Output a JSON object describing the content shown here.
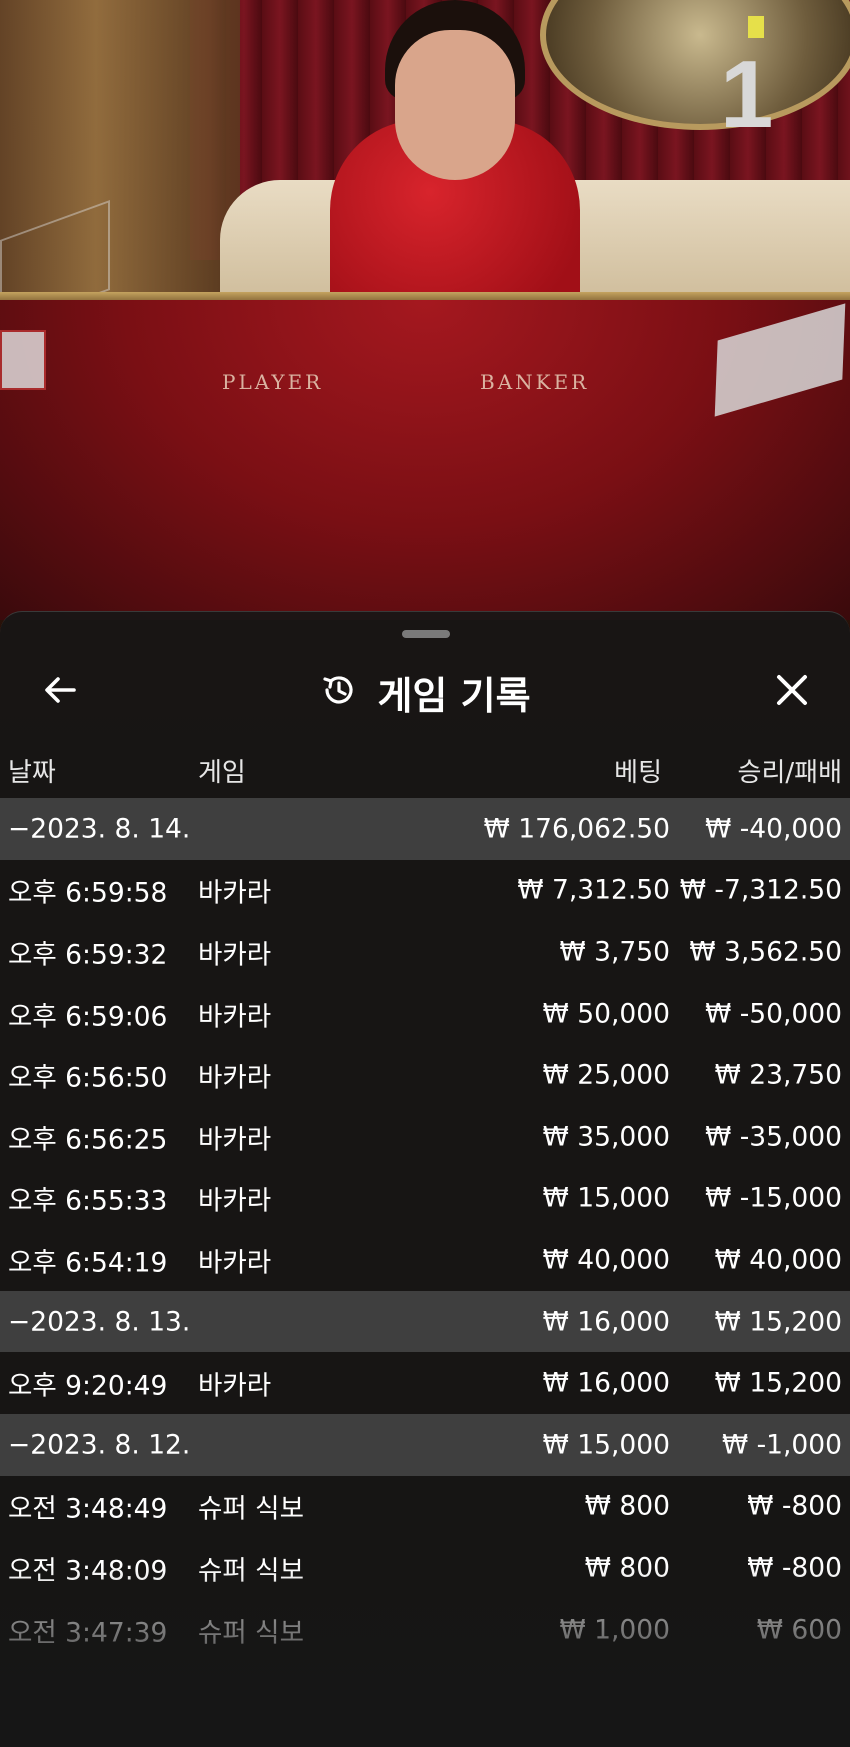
{
  "stream": {
    "round_number": "1",
    "table_labels": {
      "player": "PLAYER",
      "banker": "BANKER"
    }
  },
  "panel": {
    "title": "게임 기록",
    "icons": {
      "back": "arrow-left-icon",
      "history": "history-icon",
      "close": "close-icon"
    },
    "columns": {
      "date": "날짜",
      "game": "게임",
      "bet": "베팅",
      "win_loss": "승리/패배"
    },
    "rows": [
      {
        "type": "group",
        "date": "−2023. 8. 14.",
        "bet": "₩ 176,062.50",
        "win_loss": "₩ -40,000"
      },
      {
        "type": "entry",
        "time": "오후 6:59:58",
        "game": "바카라",
        "bet": "₩ 7,312.50",
        "win_loss": "₩ -7,312.50"
      },
      {
        "type": "entry",
        "time": "오후 6:59:32",
        "game": "바카라",
        "bet": "₩ 3,750",
        "win_loss": "₩ 3,562.50"
      },
      {
        "type": "entry",
        "time": "오후 6:59:06",
        "game": "바카라",
        "bet": "₩ 50,000",
        "win_loss": "₩ -50,000"
      },
      {
        "type": "entry",
        "time": "오후 6:56:50",
        "game": "바카라",
        "bet": "₩ 25,000",
        "win_loss": "₩ 23,750"
      },
      {
        "type": "entry",
        "time": "오후 6:56:25",
        "game": "바카라",
        "bet": "₩ 35,000",
        "win_loss": "₩ -35,000"
      },
      {
        "type": "entry",
        "time": "오후 6:55:33",
        "game": "바카라",
        "bet": "₩ 15,000",
        "win_loss": "₩ -15,000"
      },
      {
        "type": "entry",
        "time": "오후 6:54:19",
        "game": "바카라",
        "bet": "₩ 40,000",
        "win_loss": "₩ 40,000"
      },
      {
        "type": "group",
        "date": "−2023. 8. 13.",
        "bet": "₩ 16,000",
        "win_loss": "₩ 15,200"
      },
      {
        "type": "entry",
        "time": "오후 9:20:49",
        "game": "바카라",
        "bet": "₩ 16,000",
        "win_loss": "₩ 15,200"
      },
      {
        "type": "group",
        "date": "−2023. 8. 12.",
        "bet": "₩ 15,000",
        "win_loss": "₩ -1,000"
      },
      {
        "type": "entry",
        "time": "오전 3:48:49",
        "game": "슈퍼 식보",
        "bet": "₩ 800",
        "win_loss": "₩ -800"
      },
      {
        "type": "entry",
        "time": "오전 3:48:09",
        "game": "슈퍼 식보",
        "bet": "₩ 800",
        "win_loss": "₩ -800"
      },
      {
        "type": "entry",
        "time": "오전 3:47:39",
        "game": "슈퍼 식보",
        "bet": "₩ 1,000",
        "win_loss": "₩ 600"
      }
    ]
  }
}
